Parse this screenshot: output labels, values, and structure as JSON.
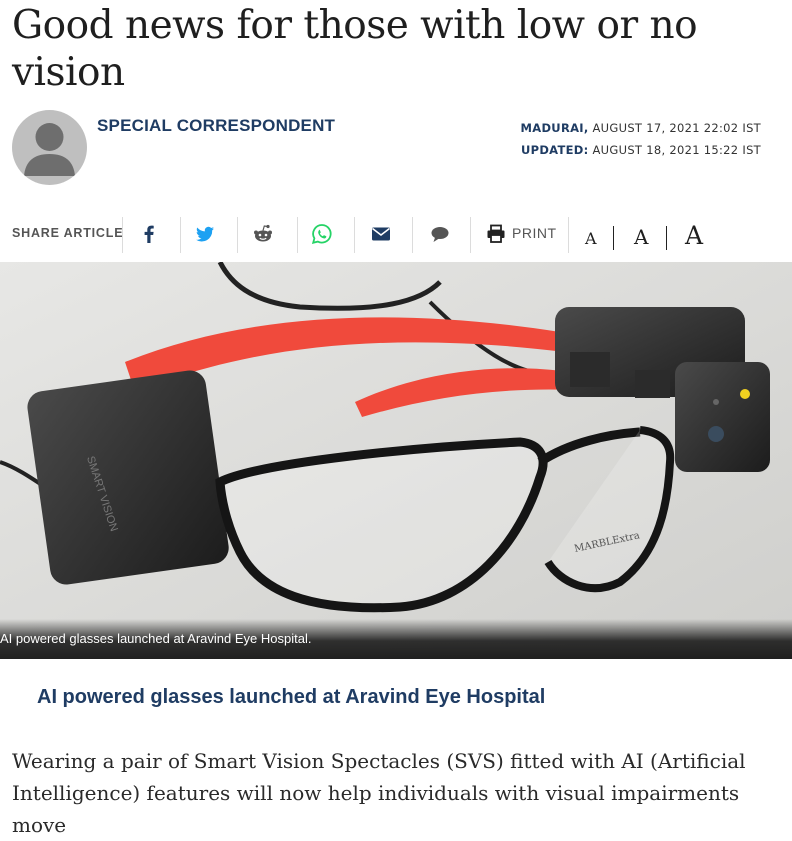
{
  "article": {
    "headline": "Good news for those with low or no vision",
    "author": "SPECIAL CORRESPONDENT",
    "dateline_place": "MADURAI,",
    "published": "AUGUST 17, 2021 22:02 IST",
    "updated_label": "UPDATED:",
    "updated": "AUGUST 18, 2021 15:22 IST",
    "image_caption": "AI powered glasses launched at Aravind Eye Hospital.",
    "subhead": "AI powered glasses launched at Aravind Eye Hospital",
    "body": "Wearing a pair of Smart Vision Spectacles (SVS) fitted with AI (Artificial Intelligence) features will now help individuals with visual impairments move"
  },
  "share": {
    "label": "SHARE ARTICLE",
    "print_label": "PRINT",
    "font_sizes": [
      "A",
      "A",
      "A"
    ],
    "icons": [
      "facebook-icon",
      "twitter-icon",
      "reddit-icon",
      "whatsapp-icon",
      "email-icon",
      "comment-icon",
      "print-icon"
    ]
  },
  "colors": {
    "brand": "#1f3c63",
    "twitter": "#1da1f2",
    "whatsapp": "#25d366",
    "frame_red": "#f04a3c"
  }
}
